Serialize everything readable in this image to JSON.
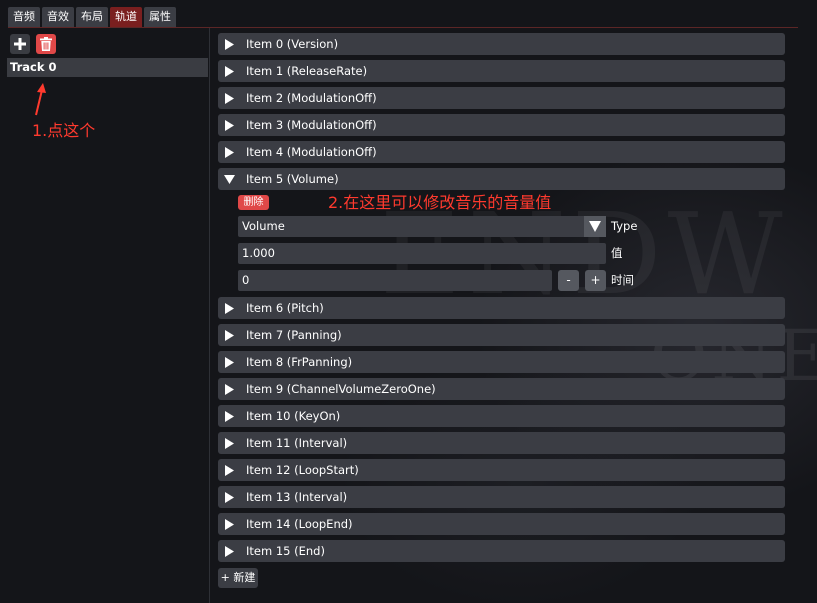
{
  "tabs": [
    "音频",
    "音效",
    "布局",
    "轨道",
    "属性"
  ],
  "active_tab": "轨道",
  "track_panel": {
    "add_icon": "plus-icon",
    "delete_icon": "trash-icon",
    "track_label": "Track 0"
  },
  "annotations": {
    "step1": "1.点这个",
    "step2": "2.在这里可以修改音乐的音量值",
    "color": "#ff3a2e"
  },
  "items": [
    {
      "label": "Item 0 (Version)",
      "expanded": false
    },
    {
      "label": "Item 1 (ReleaseRate)",
      "expanded": false
    },
    {
      "label": "Item 2 (ModulationOff)",
      "expanded": false
    },
    {
      "label": "Item 3 (ModulationOff)",
      "expanded": false
    },
    {
      "label": "Item 4 (ModulationOff)",
      "expanded": false
    },
    {
      "label": "Item 5 (Volume)",
      "expanded": true
    },
    {
      "label": "Item 6 (Pitch)",
      "expanded": false
    },
    {
      "label": "Item 7 (Panning)",
      "expanded": false
    },
    {
      "label": "Item 8 (FrPanning)",
      "expanded": false
    },
    {
      "label": "Item 9 (ChannelVolumeZeroOne)",
      "expanded": false
    },
    {
      "label": "Item 10 (KeyOn)",
      "expanded": false
    },
    {
      "label": "Item 11 (Interval)",
      "expanded": false
    },
    {
      "label": "Item 12 (LoopStart)",
      "expanded": false
    },
    {
      "label": "Item 13 (Interval)",
      "expanded": false
    },
    {
      "label": "Item 14 (LoopEnd)",
      "expanded": false
    },
    {
      "label": "Item 15 (End)",
      "expanded": false
    }
  ],
  "expanded_item": {
    "delete_label": "删除",
    "type_value": "Volume",
    "type_label": "Type",
    "value_value": "1.000",
    "value_label": "值",
    "time_value": "0",
    "time_label": "时间",
    "minus_label": "-",
    "plus_label": "+"
  },
  "new_button": "+ 新建",
  "colors": {
    "active_tab": "#7a1f1f",
    "delete_red": "#e04848",
    "row_bg": "#3b3d44"
  }
}
